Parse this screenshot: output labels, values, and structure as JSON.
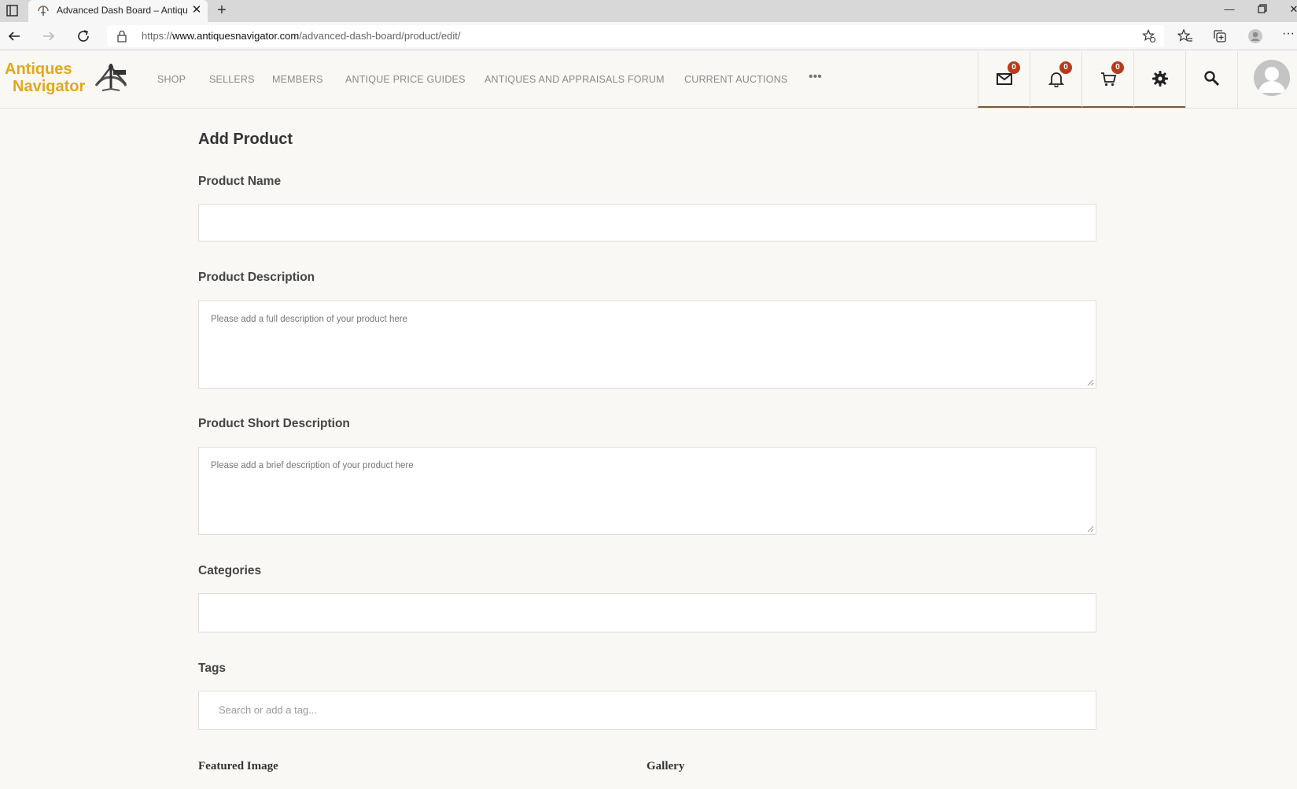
{
  "browser": {
    "tab_title": "Advanced Dash Board – Antiques Navigator",
    "url_prefix": "https://",
    "url_host": "www.antiquesnavigator.com",
    "url_path": "/advanced-dash-board/product/edit/"
  },
  "site": {
    "logo_line1": "Antiques",
    "logo_line2": "Navigator",
    "nav": [
      "SHOP",
      "SELLERS",
      "MEMBERS",
      "ANTIQUE PRICE GUIDES",
      "ANTIQUES AND APPRAISALS FORUM",
      "CURRENT AUCTIONS"
    ],
    "nav_more": "•••",
    "messages_count": "0",
    "notifications_count": "0",
    "cart_count": "0",
    "accent_color": "#e0a81b",
    "badge_color": "#b83a1d"
  },
  "form": {
    "title": "Add Product",
    "product_name_label": "Product Name",
    "product_name_value": "",
    "description_label": "Product Description",
    "description_placeholder": "Please add a full description of your product here",
    "short_description_label": "Product Short Description",
    "short_description_placeholder": "Please add a brief description of your product here",
    "categories_label": "Categories",
    "categories_value": "",
    "tags_label": "Tags",
    "tags_placeholder": "Search or add a tag...",
    "featured_image_label": "Featured Image",
    "gallery_label": "Gallery"
  }
}
